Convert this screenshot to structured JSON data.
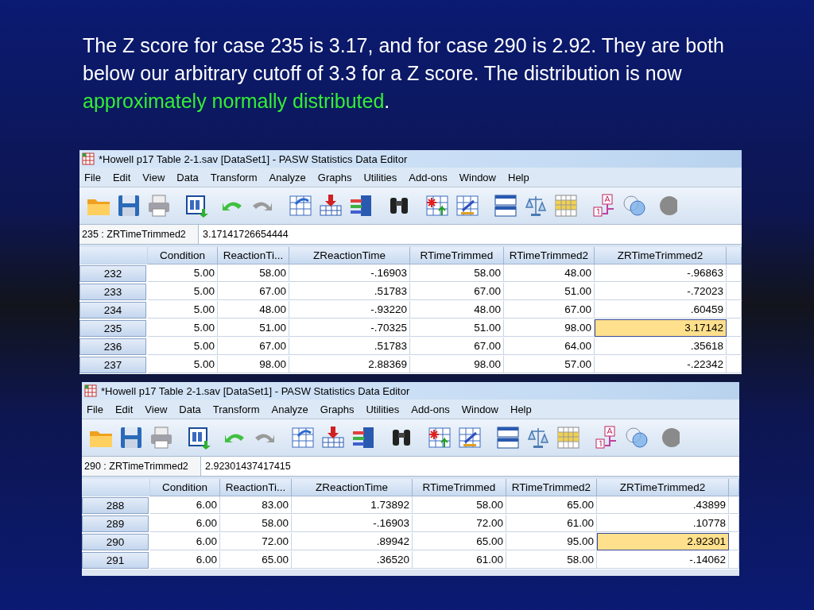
{
  "slide": {
    "paragraph": [
      {
        "text": "The Z score for case 235 is 3.17, and for case 290 is 2.92.  They are both below our arbitrary cutoff of 3.3 for a Z score. The distribution is now ",
        "highlight": false
      },
      {
        "text": "approximately normally distributed",
        "highlight": true
      },
      {
        "text": ".",
        "highlight": false
      }
    ]
  },
  "windows": [
    {
      "title": "*Howell p17 Table 2-1.sav [DataSet1] - PASW Statistics Data Editor",
      "menu": [
        "File",
        "Edit",
        "View",
        "Data",
        "Transform",
        "Analyze",
        "Graphs",
        "Utilities",
        "Add-ons",
        "Window",
        "Help"
      ],
      "cell_ref": "235 : ZRTimeTrimmed2",
      "cell_value": "3.17141726654444",
      "columns": [
        "Condition",
        "ReactionTi...",
        "ZReactionTime",
        "RTimeTrimmed",
        "RTimeTrimmed2",
        "ZRTimeTrimmed2"
      ],
      "rows": [
        {
          "case": "232",
          "cells": [
            {
              "text": "5.00",
              "selected": false
            },
            {
              "text": "58.00",
              "selected": false
            },
            {
              "text": "-.16903",
              "selected": false
            },
            {
              "text": "58.00",
              "selected": false
            },
            {
              "text": "48.00",
              "selected": false
            },
            {
              "text": "-.96863",
              "selected": false
            }
          ]
        },
        {
          "case": "233",
          "cells": [
            {
              "text": "5.00",
              "selected": false
            },
            {
              "text": "67.00",
              "selected": false
            },
            {
              "text": ".51783",
              "selected": false
            },
            {
              "text": "67.00",
              "selected": false
            },
            {
              "text": "51.00",
              "selected": false
            },
            {
              "text": "-.72023",
              "selected": false
            }
          ]
        },
        {
          "case": "234",
          "cells": [
            {
              "text": "5.00",
              "selected": false
            },
            {
              "text": "48.00",
              "selected": false
            },
            {
              "text": "-.93220",
              "selected": false
            },
            {
              "text": "48.00",
              "selected": false
            },
            {
              "text": "67.00",
              "selected": false
            },
            {
              "text": ".60459",
              "selected": false
            }
          ]
        },
        {
          "case": "235",
          "cells": [
            {
              "text": "5.00",
              "selected": false
            },
            {
              "text": "51.00",
              "selected": false
            },
            {
              "text": "-.70325",
              "selected": false
            },
            {
              "text": "51.00",
              "selected": false
            },
            {
              "text": "98.00",
              "selected": false
            },
            {
              "text": "3.17142",
              "selected": true
            }
          ]
        },
        {
          "case": "236",
          "cells": [
            {
              "text": "5.00",
              "selected": false
            },
            {
              "text": "67.00",
              "selected": false
            },
            {
              "text": ".51783",
              "selected": false
            },
            {
              "text": "67.00",
              "selected": false
            },
            {
              "text": "64.00",
              "selected": false
            },
            {
              "text": ".35618",
              "selected": false
            }
          ]
        },
        {
          "case": "237",
          "cells": [
            {
              "text": "5.00",
              "selected": false
            },
            {
              "text": "98.00",
              "selected": false
            },
            {
              "text": "2.88369",
              "selected": false
            },
            {
              "text": "98.00",
              "selected": false
            },
            {
              "text": "57.00",
              "selected": false
            },
            {
              "text": "-.22342",
              "selected": false
            }
          ]
        }
      ]
    },
    {
      "title": "*Howell p17 Table 2-1.sav [DataSet1] - PASW Statistics Data Editor",
      "menu": [
        "File",
        "Edit",
        "View",
        "Data",
        "Transform",
        "Analyze",
        "Graphs",
        "Utilities",
        "Add-ons",
        "Window",
        "Help"
      ],
      "cell_ref": "290 : ZRTimeTrimmed2",
      "cell_value": "2.92301437417415",
      "columns": [
        "Condition",
        "ReactionTi...",
        "ZReactionTime",
        "RTimeTrimmed",
        "RTimeTrimmed2",
        "ZRTimeTrimmed2"
      ],
      "rows": [
        {
          "case": "288",
          "cells": [
            {
              "text": "6.00",
              "selected": false
            },
            {
              "text": "83.00",
              "selected": false
            },
            {
              "text": "1.73892",
              "selected": false
            },
            {
              "text": "58.00",
              "selected": false
            },
            {
              "text": "65.00",
              "selected": false
            },
            {
              "text": ".43899",
              "selected": false
            }
          ]
        },
        {
          "case": "289",
          "cells": [
            {
              "text": "6.00",
              "selected": false
            },
            {
              "text": "58.00",
              "selected": false
            },
            {
              "text": "-.16903",
              "selected": false
            },
            {
              "text": "72.00",
              "selected": false
            },
            {
              "text": "61.00",
              "selected": false
            },
            {
              "text": ".10778",
              "selected": false
            }
          ]
        },
        {
          "case": "290",
          "cells": [
            {
              "text": "6.00",
              "selected": false
            },
            {
              "text": "72.00",
              "selected": false
            },
            {
              "text": ".89942",
              "selected": false
            },
            {
              "text": "65.00",
              "selected": false
            },
            {
              "text": "95.00",
              "selected": false
            },
            {
              "text": "2.92301",
              "selected": true
            }
          ]
        },
        {
          "case": "291",
          "cells": [
            {
              "text": "6.00",
              "selected": false
            },
            {
              "text": "65.00",
              "selected": false
            },
            {
              "text": ".36520",
              "selected": false
            },
            {
              "text": "61.00",
              "selected": false
            },
            {
              "text": "58.00",
              "selected": false
            },
            {
              "text": "-.14062",
              "selected": false
            }
          ]
        }
      ]
    }
  ]
}
